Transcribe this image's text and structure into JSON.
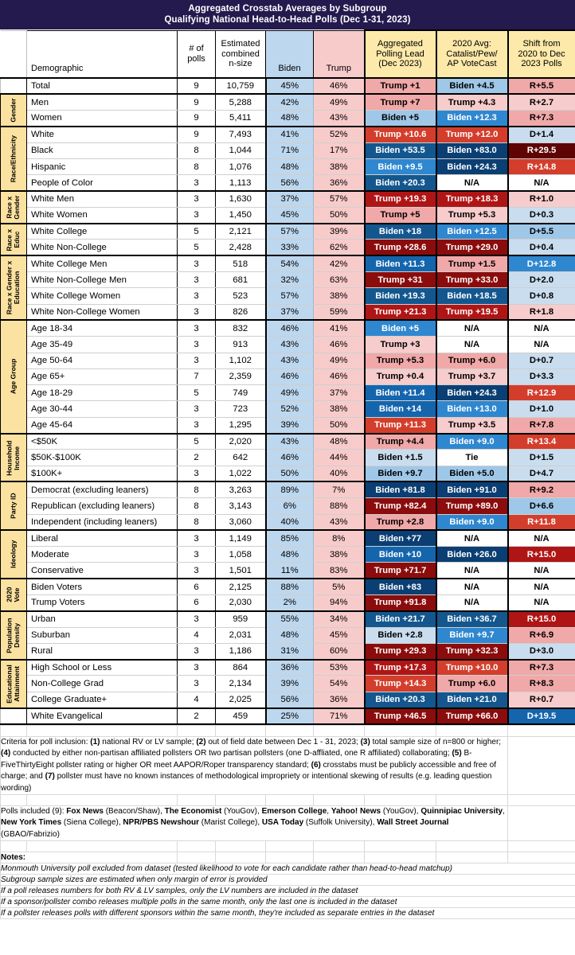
{
  "title": {
    "line1": "Aggregated Crosstab Averages by Subgroup",
    "line2": "Qualifying National Head-to-Head Polls (Dec 1-31, 2023)"
  },
  "columns": {
    "category": "",
    "demographic": "Demographic",
    "polls": "# of polls",
    "nsize": "Estimated combined n-size",
    "biden": "Biden",
    "trump": "Trump",
    "lead": "Aggregated Polling Lead (Dec 2023)",
    "avg2020": "2020 Avg: Catalist/Pew/ AP VoteCast",
    "shift": "Shift from 2020 to Dec 2023 Polls"
  },
  "column_header_lines": {
    "polls": [
      "# of",
      "polls"
    ],
    "nsize": [
      "Estimated",
      "combined",
      "n-size"
    ],
    "lead": [
      "Aggregated",
      "Polling Lead",
      "(Dec 2023)"
    ],
    "avg2020": [
      "2020 Avg:",
      "Catalist/Pew/",
      "AP VoteCast"
    ],
    "shift": [
      "Shift from",
      "2020 to Dec",
      "2023 Polls"
    ]
  },
  "colors": {
    "title_bar": "#241a4e",
    "category_label": "#fbe2a0",
    "header_highlight": "#fde9a9",
    "biden_column": "#bdd7ee",
    "trump_column": "#f8cbcb"
  },
  "groups": [
    {
      "label": "",
      "rows": [
        {
          "demographic": "Total",
          "polls": "9",
          "nsize": "10,759",
          "biden": "45%",
          "trump": "46%",
          "lead": "Trump +1",
          "lead_c": "s-r1",
          "avg": "Biden +4.5",
          "avg_c": "s-b1",
          "shift": "R+5.5",
          "shift_c": "s-r1"
        }
      ]
    },
    {
      "label": "Gender",
      "rows": [
        {
          "demographic": "Men",
          "polls": "9",
          "nsize": "5,288",
          "biden": "42%",
          "trump": "49%",
          "lead": "Trump +7",
          "lead_c": "s-r1",
          "avg": "Trump +4.3",
          "avg_c": "s-r0",
          "shift": "R+2.7",
          "shift_c": "s-r0"
        },
        {
          "demographic": "Women",
          "polls": "9",
          "nsize": "5,411",
          "biden": "48%",
          "trump": "43%",
          "lead": "Biden +5",
          "lead_c": "s-b1",
          "avg": "Biden +12.3",
          "avg_c": "s-b2",
          "shift": "R+7.3",
          "shift_c": "s-r1"
        }
      ]
    },
    {
      "label": "Race/Ethnicity",
      "rows": [
        {
          "demographic": "White",
          "polls": "9",
          "nsize": "7,493",
          "biden": "41%",
          "trump": "52%",
          "lead": "Trump +10.6",
          "lead_c": "s-r3",
          "avg": "Trump +12.0",
          "avg_c": "s-r3",
          "shift": "D+1.4",
          "shift_c": "s-b0"
        },
        {
          "demographic": "Black",
          "polls": "8",
          "nsize": "1,044",
          "biden": "71%",
          "trump": "17%",
          "lead": "Biden +53.5",
          "lead_c": "s-b4",
          "avg": "Biden +83.0",
          "avg_c": "s-b5",
          "shift": "R+29.5",
          "shift_c": "s-r6"
        },
        {
          "demographic": "Hispanic",
          "polls": "8",
          "nsize": "1,076",
          "biden": "48%",
          "trump": "38%",
          "lead": "Biden +9.5",
          "lead_c": "s-b2",
          "avg": "Biden +24.3",
          "avg_c": "s-b5",
          "shift": "R+14.8",
          "shift_c": "s-r3"
        },
        {
          "demographic": "People of Color",
          "polls": "3",
          "nsize": "1,113",
          "biden": "56%",
          "trump": "36%",
          "lead": "Biden +20.3",
          "lead_c": "s-b4",
          "avg": "N/A",
          "avg_c": "s-n",
          "shift": "N/A",
          "shift_c": "s-n"
        }
      ]
    },
    {
      "label": "Race x Gender",
      "rows": [
        {
          "demographic": "White Men",
          "polls": "3",
          "nsize": "1,630",
          "biden": "37%",
          "trump": "57%",
          "lead": "Trump +19.3",
          "lead_c": "s-r4",
          "avg": "Trump +18.3",
          "avg_c": "s-r4",
          "shift": "R+1.0",
          "shift_c": "s-r0"
        },
        {
          "demographic": "White Women",
          "polls": "3",
          "nsize": "1,450",
          "biden": "45%",
          "trump": "50%",
          "lead": "Trump +5",
          "lead_c": "s-r1",
          "avg": "Trump +5.3",
          "avg_c": "s-r0",
          "shift": "D+0.3",
          "shift_c": "s-b0"
        }
      ]
    },
    {
      "label": "Race x Educ",
      "rows": [
        {
          "demographic": "White College",
          "polls": "5",
          "nsize": "2,121",
          "biden": "57%",
          "trump": "39%",
          "lead": "Biden +18",
          "lead_c": "s-b4",
          "avg": "Biden +12.5",
          "avg_c": "s-b2",
          "shift": "D+5.5",
          "shift_c": "s-b1"
        },
        {
          "demographic": "White Non-College",
          "polls": "5",
          "nsize": "2,428",
          "biden": "33%",
          "trump": "62%",
          "lead": "Trump +28.6",
          "lead_c": "s-r5",
          "avg": "Trump +29.0",
          "avg_c": "s-r5",
          "shift": "D+0.4",
          "shift_c": "s-b0"
        }
      ]
    },
    {
      "label": "Race x Gender x Education",
      "rows": [
        {
          "demographic": "White College Men",
          "polls": "3",
          "nsize": "518",
          "biden": "54%",
          "trump": "42%",
          "lead": "Biden +11.3",
          "lead_c": "s-b3",
          "avg": "Trump +1.5",
          "avg_c": "s-r1",
          "shift": "D+12.8",
          "shift_c": "s-b2"
        },
        {
          "demographic": "White Non-College Men",
          "polls": "3",
          "nsize": "681",
          "biden": "32%",
          "trump": "63%",
          "lead": "Trump +31",
          "lead_c": "s-r5",
          "avg": "Trump +33.0",
          "avg_c": "s-r5",
          "shift": "D+2.0",
          "shift_c": "s-b0"
        },
        {
          "demographic": "White College Women",
          "polls": "3",
          "nsize": "523",
          "biden": "57%",
          "trump": "38%",
          "lead": "Biden +19.3",
          "lead_c": "s-b4",
          "avg": "Biden +18.5",
          "avg_c": "s-b4",
          "shift": "D+0.8",
          "shift_c": "s-b0"
        },
        {
          "demographic": "White Non-College Women",
          "polls": "3",
          "nsize": "826",
          "biden": "37%",
          "trump": "59%",
          "lead": "Trump +21.3",
          "lead_c": "s-r4",
          "avg": "Trump +19.5",
          "avg_c": "s-r4",
          "shift": "R+1.8",
          "shift_c": "s-r0"
        }
      ]
    },
    {
      "label": "Age Group",
      "rows": [
        {
          "demographic": "Age 18-34",
          "polls": "3",
          "nsize": "832",
          "biden": "46%",
          "trump": "41%",
          "lead": "Biden +5",
          "lead_c": "s-b2",
          "avg": "N/A",
          "avg_c": "s-n",
          "shift": "N/A",
          "shift_c": "s-n"
        },
        {
          "demographic": "Age 35-49",
          "polls": "3",
          "nsize": "913",
          "biden": "43%",
          "trump": "46%",
          "lead": "Trump +3",
          "lead_c": "s-r0",
          "avg": "N/A",
          "avg_c": "s-n",
          "shift": "N/A",
          "shift_c": "s-n"
        },
        {
          "demographic": "Age 50-64",
          "polls": "3",
          "nsize": "1,102",
          "biden": "43%",
          "trump": "49%",
          "lead": "Trump +5.3",
          "lead_c": "s-r1",
          "avg": "Trump +6.0",
          "avg_c": "s-r1",
          "shift": "D+0.7",
          "shift_c": "s-b0"
        },
        {
          "demographic": "Age 65+",
          "polls": "7",
          "nsize": "2,359",
          "biden": "46%",
          "trump": "46%",
          "lead": "Trump +0.4",
          "lead_c": "s-r0",
          "avg": "Trump +3.7",
          "avg_c": "s-r0",
          "shift": "D+3.3",
          "shift_c": "s-b0"
        },
        {
          "demographic": "Age 18-29",
          "polls": "5",
          "nsize": "749",
          "biden": "49%",
          "trump": "37%",
          "lead": "Biden +11.4",
          "lead_c": "s-b3",
          "avg": "Biden +24.3",
          "avg_c": "s-b5",
          "shift": "R+12.9",
          "shift_c": "s-r3"
        },
        {
          "demographic": "Age 30-44",
          "polls": "3",
          "nsize": "723",
          "biden": "52%",
          "trump": "38%",
          "lead": "Biden +14",
          "lead_c": "s-b3",
          "avg": "Biden +13.0",
          "avg_c": "s-b2",
          "shift": "D+1.0",
          "shift_c": "s-b0"
        },
        {
          "demographic": "Age 45-64",
          "polls": "3",
          "nsize": "1,295",
          "biden": "39%",
          "trump": "50%",
          "lead": "Trump +11.3",
          "lead_c": "s-r3",
          "avg": "Trump +3.5",
          "avg_c": "s-r0",
          "shift": "R+7.8",
          "shift_c": "s-r1"
        }
      ]
    },
    {
      "label": "Household Income",
      "rows": [
        {
          "demographic": "<$50K",
          "polls": "5",
          "nsize": "2,020",
          "biden": "43%",
          "trump": "48%",
          "lead": "Trump +4.4",
          "lead_c": "s-r1",
          "avg": "Biden +9.0",
          "avg_c": "s-b2",
          "shift": "R+13.4",
          "shift_c": "s-r3"
        },
        {
          "demographic": "$50K-$100K",
          "polls": "2",
          "nsize": "642",
          "biden": "46%",
          "trump": "44%",
          "lead": "Biden +1.5",
          "lead_c": "s-b0",
          "avg": "Tie",
          "avg_c": "s-n",
          "shift": "D+1.5",
          "shift_c": "s-b0"
        },
        {
          "demographic": "$100K+",
          "polls": "3",
          "nsize": "1,022",
          "biden": "50%",
          "trump": "40%",
          "lead": "Biden +9.7",
          "lead_c": "s-b1",
          "avg": "Biden +5.0",
          "avg_c": "s-b1",
          "shift": "D+4.7",
          "shift_c": "s-b0"
        }
      ]
    },
    {
      "label": "Party ID",
      "rows": [
        {
          "demographic": "Democrat (excluding leaners)",
          "polls": "8",
          "nsize": "3,263",
          "biden": "89%",
          "trump": "7%",
          "lead": "Biden +81.8",
          "lead_c": "s-b5",
          "avg": "Biden +91.0",
          "avg_c": "s-b5",
          "shift": "R+9.2",
          "shift_c": "s-r1"
        },
        {
          "demographic": "Republican (excluding leaners)",
          "polls": "8",
          "nsize": "3,143",
          "biden": "6%",
          "trump": "88%",
          "lead": "Trump +82.4",
          "lead_c": "s-r5",
          "avg": "Trump +89.0",
          "avg_c": "s-r5",
          "shift": "D+6.6",
          "shift_c": "s-b1"
        },
        {
          "demographic": "Independent (including leaners)",
          "polls": "8",
          "nsize": "3,060",
          "biden": "40%",
          "trump": "43%",
          "lead": "Trump +2.8",
          "lead_c": "s-r1",
          "avg": "Biden +9.0",
          "avg_c": "s-b2",
          "shift": "R+11.8",
          "shift_c": "s-r3"
        }
      ]
    },
    {
      "label": "Ideology",
      "rows": [
        {
          "demographic": "Liberal",
          "polls": "3",
          "nsize": "1,149",
          "biden": "85%",
          "trump": "8%",
          "lead": "Biden +77",
          "lead_c": "s-b5",
          "avg": "N/A",
          "avg_c": "s-n",
          "shift": "N/A",
          "shift_c": "s-n"
        },
        {
          "demographic": "Moderate",
          "polls": "3",
          "nsize": "1,058",
          "biden": "48%",
          "trump": "38%",
          "lead": "Biden +10",
          "lead_c": "s-b3",
          "avg": "Biden +26.0",
          "avg_c": "s-b5",
          "shift": "R+15.0",
          "shift_c": "s-r4"
        },
        {
          "demographic": "Conservative",
          "polls": "3",
          "nsize": "1,501",
          "biden": "11%",
          "trump": "83%",
          "lead": "Trump +71.7",
          "lead_c": "s-r5",
          "avg": "N/A",
          "avg_c": "s-n",
          "shift": "N/A",
          "shift_c": "s-n"
        }
      ]
    },
    {
      "label": "2020 Vote",
      "rows": [
        {
          "demographic": "Biden Voters",
          "polls": "6",
          "nsize": "2,125",
          "biden": "88%",
          "trump": "5%",
          "lead": "Biden +83",
          "lead_c": "s-b5",
          "avg": "N/A",
          "avg_c": "s-n",
          "shift": "N/A",
          "shift_c": "s-n"
        },
        {
          "demographic": "Trump Voters",
          "polls": "6",
          "nsize": "2,030",
          "biden": "2%",
          "trump": "94%",
          "lead": "Trump +91.8",
          "lead_c": "s-r5",
          "avg": "N/A",
          "avg_c": "s-n",
          "shift": "N/A",
          "shift_c": "s-n"
        }
      ]
    },
    {
      "label": "Population Density",
      "rows": [
        {
          "demographic": "Urban",
          "polls": "3",
          "nsize": "959",
          "biden": "55%",
          "trump": "34%",
          "lead": "Biden +21.7",
          "lead_c": "s-b4",
          "avg": "Biden +36.7",
          "avg_c": "s-b4",
          "shift": "R+15.0",
          "shift_c": "s-r4"
        },
        {
          "demographic": "Suburban",
          "polls": "4",
          "nsize": "2,031",
          "biden": "48%",
          "trump": "45%",
          "lead": "Biden +2.8",
          "lead_c": "s-b0",
          "avg": "Biden +9.7",
          "avg_c": "s-b2",
          "shift": "R+6.9",
          "shift_c": "s-r1"
        },
        {
          "demographic": "Rural",
          "polls": "3",
          "nsize": "1,186",
          "biden": "31%",
          "trump": "60%",
          "lead": "Trump +29.3",
          "lead_c": "s-r5",
          "avg": "Trump +32.3",
          "avg_c": "s-r5",
          "shift": "D+3.0",
          "shift_c": "s-b0"
        }
      ]
    },
    {
      "label": "Educational Attainment",
      "rows": [
        {
          "demographic": "High School or Less",
          "polls": "3",
          "nsize": "864",
          "biden": "36%",
          "trump": "53%",
          "lead": "Trump +17.3",
          "lead_c": "s-r4",
          "avg": "Trump +10.0",
          "avg_c": "s-r3",
          "shift": "R+7.3",
          "shift_c": "s-r1"
        },
        {
          "demographic": "Non-College Grad",
          "polls": "3",
          "nsize": "2,134",
          "biden": "39%",
          "trump": "54%",
          "lead": "Trump +14.3",
          "lead_c": "s-r3",
          "avg": "Trump +6.0",
          "avg_c": "s-r1",
          "shift": "R+8.3",
          "shift_c": "s-r1"
        },
        {
          "demographic": "College Graduate+",
          "polls": "4",
          "nsize": "2,025",
          "biden": "56%",
          "trump": "36%",
          "lead": "Biden +20.3",
          "lead_c": "s-b4",
          "avg": "Biden +21.0",
          "avg_c": "s-b4",
          "shift": "R+0.7",
          "shift_c": "s-r0"
        }
      ]
    },
    {
      "label": "",
      "rows": [
        {
          "demographic": "White Evangelical",
          "polls": "2",
          "nsize": "459",
          "biden": "25%",
          "trump": "71%",
          "lead": "Trump +46.5",
          "lead_c": "s-r5",
          "avg": "Trump +66.0",
          "avg_c": "s-r5",
          "shift": "D+19.5",
          "shift_c": "s-b3"
        }
      ]
    }
  ],
  "footnotes": {
    "criteria_intro": "Criteria for poll inclusion: ",
    "criteria_parts": [
      {
        "n": "(1)",
        "t": " national RV or LV sample; "
      },
      {
        "n": "(2)",
        "t": " out of field date between Dec 1 - 31, 2023; "
      },
      {
        "n": "(3)",
        "t": " total sample size of n=800 or higher; "
      },
      {
        "n": "(4)",
        "t": " conducted by either non-partisan  affiliated pollsters OR two partisan pollsters (one D-affliated, one R affiliated) collaborating; "
      },
      {
        "n": "(5)",
        "t": " B- FiveThirtyEight pollster rating or higher OR meet AAPOR/Roper transparency standard; "
      },
      {
        "n": "(6)",
        "t": " crosstabs must be publicly accessible and free of charge; and "
      },
      {
        "n": "(7)",
        "t": " pollster must have no known instances of methodological impropriety or intentional skewing of results (e.g. leading question wording)"
      }
    ],
    "polls_intro": "Polls included (9): ",
    "polls_list": [
      {
        "b": "Fox News",
        "t": " (Beacon/Shaw), "
      },
      {
        "b": "The Economist",
        "t": " (YouGov), "
      },
      {
        "b": "Emerson College",
        "t": ", "
      },
      {
        "b": "Yahoo! News",
        "t": " (YouGov), "
      },
      {
        "b": "Quinnipiac University",
        "t": ", "
      },
      {
        "b": "New York Times",
        "t": " (Siena College), "
      },
      {
        "b": "NPR/PBS Newshour",
        "t": " (Marist College), "
      },
      {
        "b": "USA Today",
        "t": " (Suffolk University), "
      },
      {
        "b": "Wall Street Journal",
        "t": " (GBAO/Fabrizio)"
      }
    ],
    "notes_header": "Notes:",
    "notes": [
      "Monmouth University poll excluded from dataset (tested likelihood to vote for each candidate rather than head-to-head matchup)",
      "Subgroup sample sizes are estimated when only margin of error is provided",
      "If a poll releases numbers for both RV & LV samples, only the LV numbers are included in the dataset",
      "If a sponsor/pollster combo releases multiple polls in the same month, only the last one is included in the dataset",
      "If a pollster releases polls with different sponsors within the same month, they're included as separate entries in the dataset"
    ]
  }
}
